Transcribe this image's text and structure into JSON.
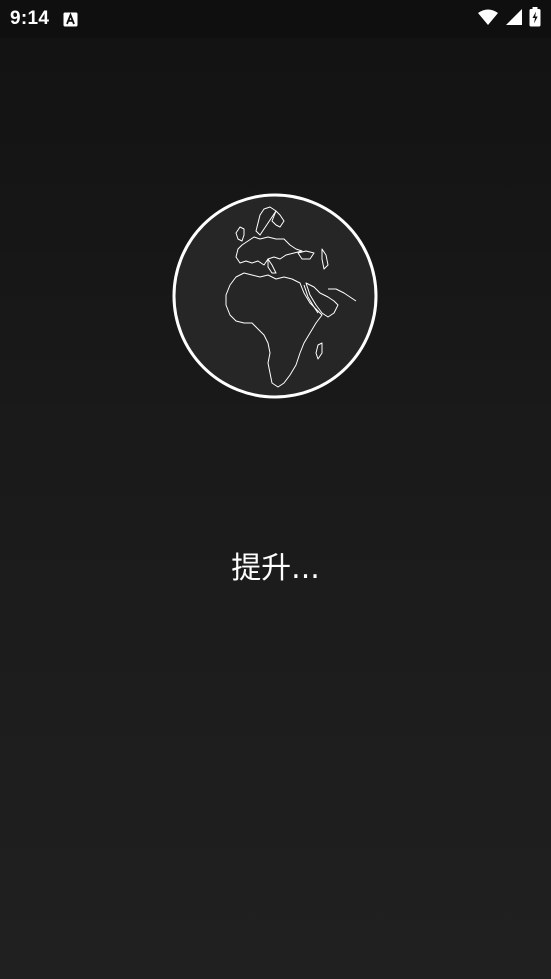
{
  "status_bar": {
    "time": "9:14",
    "icons": [
      "text-a-notification-icon",
      "wifi-icon",
      "cellular-signal-icon",
      "battery-charging-icon"
    ]
  },
  "splash": {
    "illustration": "globe-icon",
    "loading_text": "提升..."
  },
  "colors": {
    "background_top": "#121212",
    "background_bottom": "#202020",
    "globe_fill": "#262626",
    "globe_stroke": "#ffffff",
    "text": "#ffffff"
  }
}
